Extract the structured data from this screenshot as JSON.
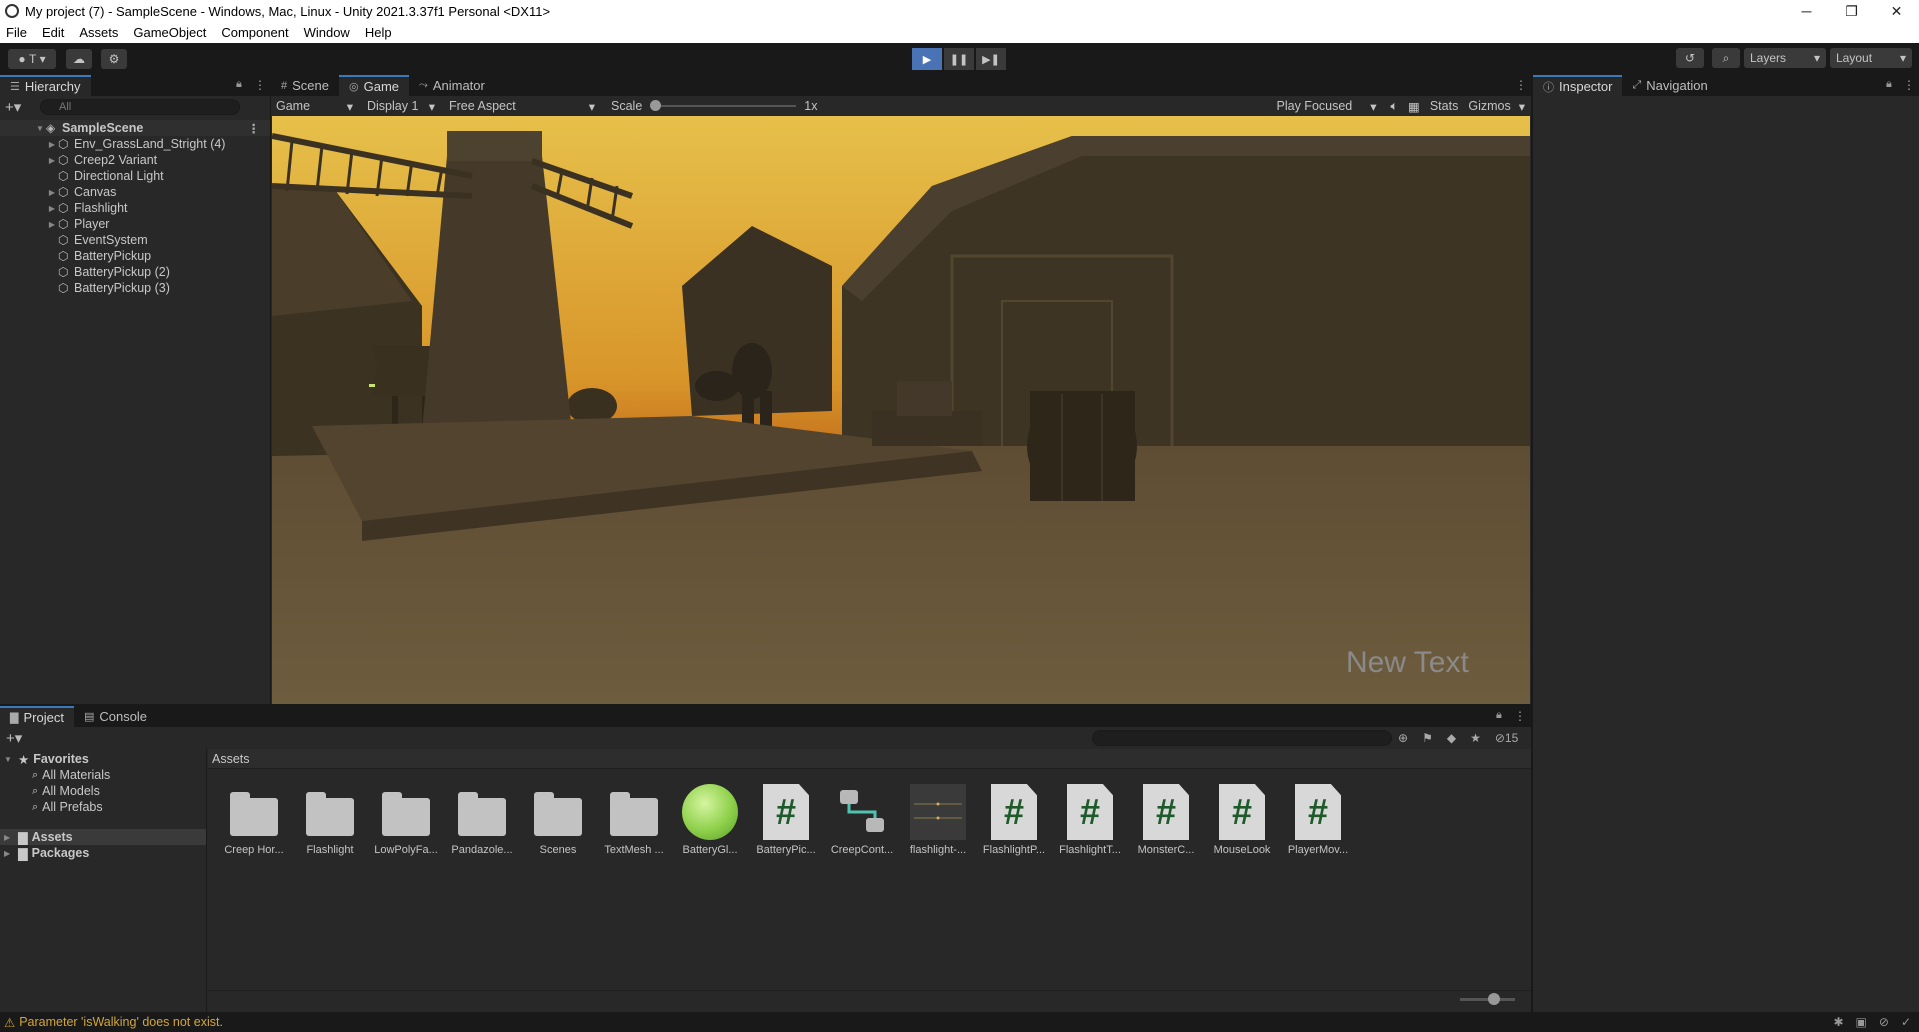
{
  "window": {
    "title": "My project (7) - SampleScene - Windows, Mac, Linux - Unity 2021.3.37f1 Personal <DX11>",
    "minimize": "─",
    "maximize": "❐",
    "close": "✕"
  },
  "menubar": [
    "File",
    "Edit",
    "Assets",
    "GameObject",
    "Component",
    "Window",
    "Help"
  ],
  "toolbar": {
    "account_label": "T",
    "layers_label": "Layers",
    "layout_label": "Layout"
  },
  "hierarchy": {
    "tab_label": "Hierarchy",
    "search_placeholder": "All",
    "scene_name": "SampleScene",
    "items": [
      {
        "label": "Env_GrassLand_Stright (4)",
        "expandable": true
      },
      {
        "label": "Creep2 Variant",
        "expandable": true
      },
      {
        "label": "Directional Light",
        "expandable": false
      },
      {
        "label": "Canvas",
        "expandable": true
      },
      {
        "label": "Flashlight",
        "expandable": true
      },
      {
        "label": "Player",
        "expandable": true
      },
      {
        "label": "EventSystem",
        "expandable": false
      },
      {
        "label": "BatteryPickup",
        "expandable": false
      },
      {
        "label": "BatteryPickup (2)",
        "expandable": false
      },
      {
        "label": "BatteryPickup (3)",
        "expandable": false
      }
    ]
  },
  "gameview": {
    "tabs": [
      "Scene",
      "Game",
      "Animator"
    ],
    "active_tab": "Game",
    "mode_dropdown": "Game",
    "display_dropdown": "Display 1",
    "aspect_dropdown": "Free Aspect",
    "scale_label": "Scale",
    "scale_value": "1x",
    "play_focused": "Play Focused",
    "stats": "Stats",
    "gizmos": "Gizmos",
    "overlay_text": "New Text"
  },
  "inspector": {
    "tabs": [
      "Inspector",
      "Navigation"
    ]
  },
  "project": {
    "tabs": [
      "Project",
      "Console"
    ],
    "favorites_label": "Favorites",
    "favorites": [
      "All Materials",
      "All Models",
      "All Prefabs"
    ],
    "roots": [
      "Assets",
      "Packages"
    ],
    "breadcrumb": "Assets",
    "hidden_count": "15",
    "assets": [
      {
        "label": "Creep Hor...",
        "kind": "folder"
      },
      {
        "label": "Flashlight",
        "kind": "folder"
      },
      {
        "label": "LowPolyFa...",
        "kind": "folder"
      },
      {
        "label": "Pandazole...",
        "kind": "folder"
      },
      {
        "label": "Scenes",
        "kind": "folder"
      },
      {
        "label": "TextMesh ...",
        "kind": "folder"
      },
      {
        "label": "BatteryGl...",
        "kind": "material"
      },
      {
        "label": "BatteryPic...",
        "kind": "script"
      },
      {
        "label": "CreepCont...",
        "kind": "controller"
      },
      {
        "label": "flashlight-...",
        "kind": "animclip"
      },
      {
        "label": "FlashlightP...",
        "kind": "script"
      },
      {
        "label": "FlashlightT...",
        "kind": "script"
      },
      {
        "label": "MonsterC...",
        "kind": "script"
      },
      {
        "label": "MouseLook",
        "kind": "script"
      },
      {
        "label": "PlayerMov...",
        "kind": "script"
      }
    ]
  },
  "status": {
    "message": "Parameter 'isWalking' does not exist."
  },
  "colors": {
    "accent": "#3a79bb",
    "play_active": "#4a73b6",
    "warning": "#d2a63a"
  }
}
